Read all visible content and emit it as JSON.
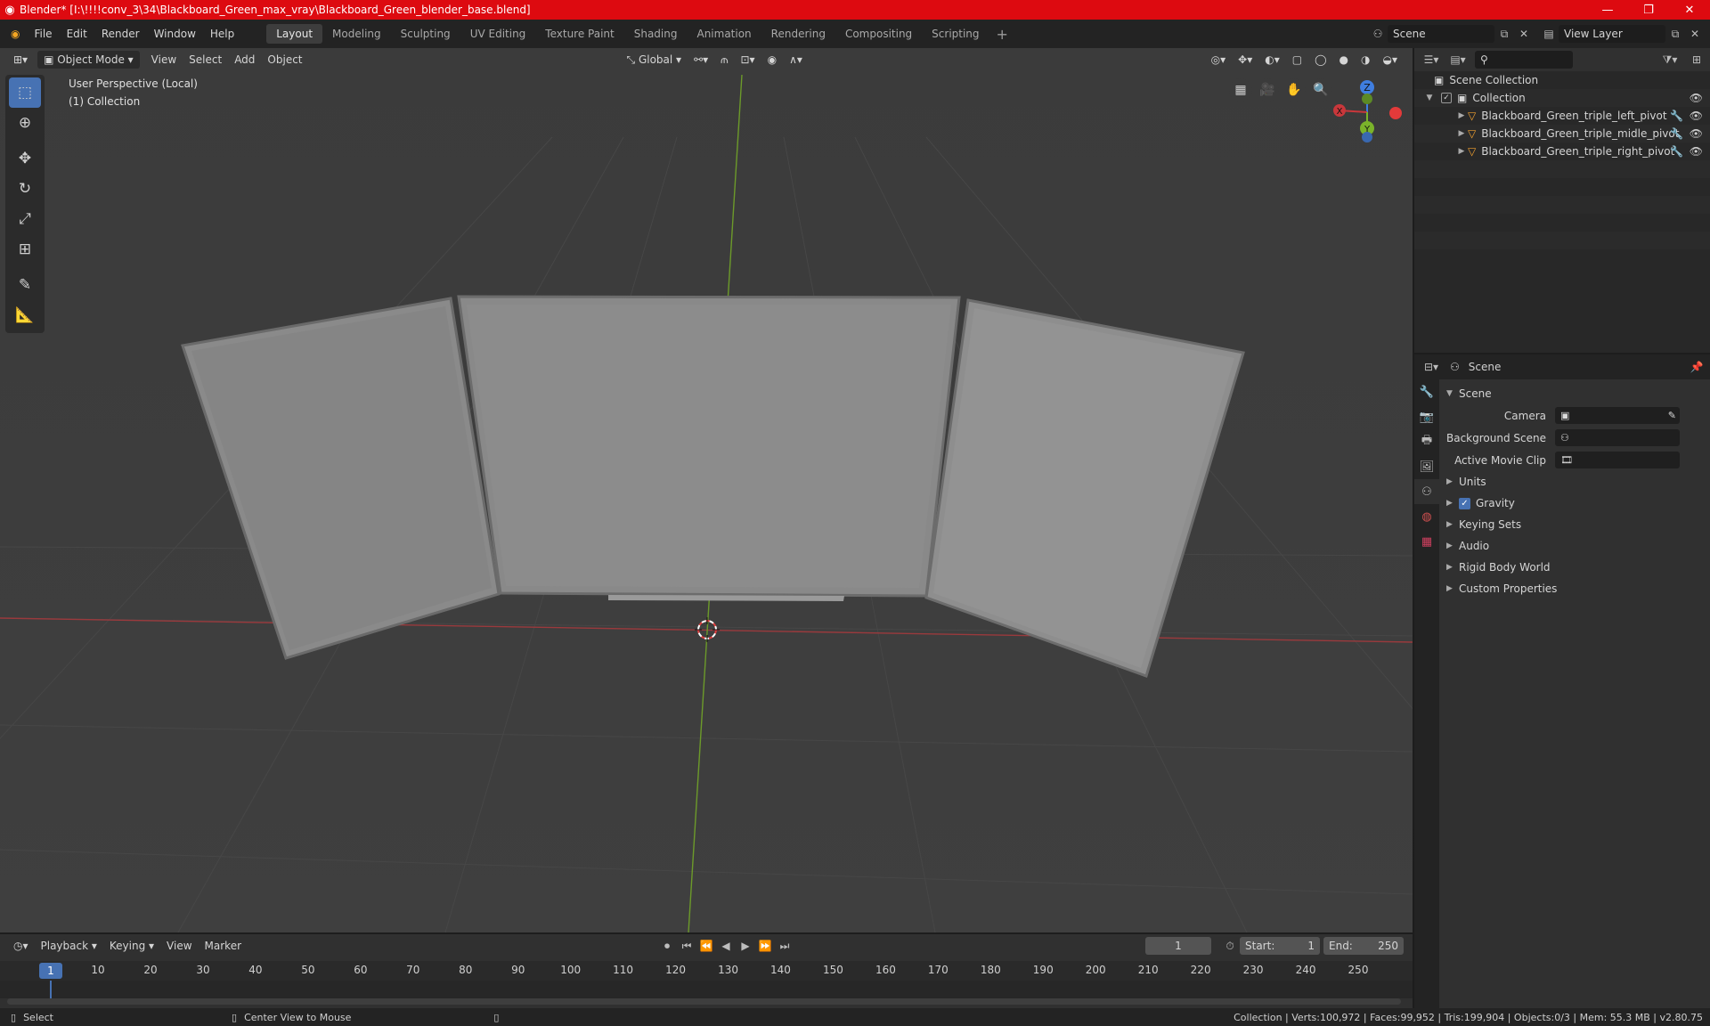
{
  "window": {
    "title": "Blender* [I:\\!!!!conv_3\\34\\Blackboard_Green_max_vray\\Blackboard_Green_blender_base.blend]",
    "controls": {
      "minimize": "—",
      "maximize": "❐",
      "close": "✕"
    }
  },
  "menu": {
    "items": [
      "File",
      "Edit",
      "Render",
      "Window",
      "Help"
    ],
    "workspaces": [
      "Layout",
      "Modeling",
      "Sculpting",
      "UV Editing",
      "Texture Paint",
      "Shading",
      "Animation",
      "Rendering",
      "Compositing",
      "Scripting"
    ],
    "active_workspace": "Layout",
    "add_workspace": "+",
    "scene": "Scene",
    "view_layer": "View Layer"
  },
  "viewport": {
    "mode": "Object Mode",
    "menus": [
      "View",
      "Select",
      "Add",
      "Object"
    ],
    "orientation": "Global",
    "info_line1": "User Perspective (Local)",
    "info_line2": "(1) Collection",
    "gizmo": {
      "x": "X",
      "y": "Y",
      "z": "Z"
    }
  },
  "outliner": {
    "search_placeholder": "",
    "root": "Scene Collection",
    "collection": "Collection",
    "objects": [
      "Blackboard_Green_triple_left_pivot",
      "Blackboard_Green_triple_midle_pivot",
      "Blackboard_Green_triple_right_pivot"
    ]
  },
  "properties": {
    "header": "Scene",
    "section": "Scene",
    "camera_label": "Camera",
    "background_scene_label": "Background Scene",
    "active_movie_clip_label": "Active Movie Clip",
    "subsections": [
      "Units",
      "Gravity",
      "Keying Sets",
      "Audio",
      "Rigid Body World",
      "Custom Properties"
    ],
    "gravity_checked": true
  },
  "timeline": {
    "menus": [
      "Playback",
      "Keying",
      "View",
      "Marker"
    ],
    "current_frame": "1",
    "start_label": "Start:",
    "start": "1",
    "end_label": "End:",
    "end": "250",
    "ticks": [
      "1",
      "10",
      "20",
      "30",
      "40",
      "50",
      "60",
      "70",
      "80",
      "90",
      "100",
      "110",
      "120",
      "130",
      "140",
      "150",
      "160",
      "170",
      "180",
      "190",
      "200",
      "210",
      "220",
      "230",
      "240",
      "250"
    ]
  },
  "status": {
    "select": "Select",
    "center": "Center View to Mouse",
    "stats": "Collection | Verts:100,972 | Faces:99,952 | Tris:199,904 | Objects:0/3 | Mem: 55.3 MB | v2.80.75"
  },
  "colors": {
    "accent": "#4772b3",
    "titlebar": "#dd0a10",
    "x_axis": "#c9373b",
    "y_axis": "#7ab32a",
    "z_axis": "#3f7ee0"
  }
}
